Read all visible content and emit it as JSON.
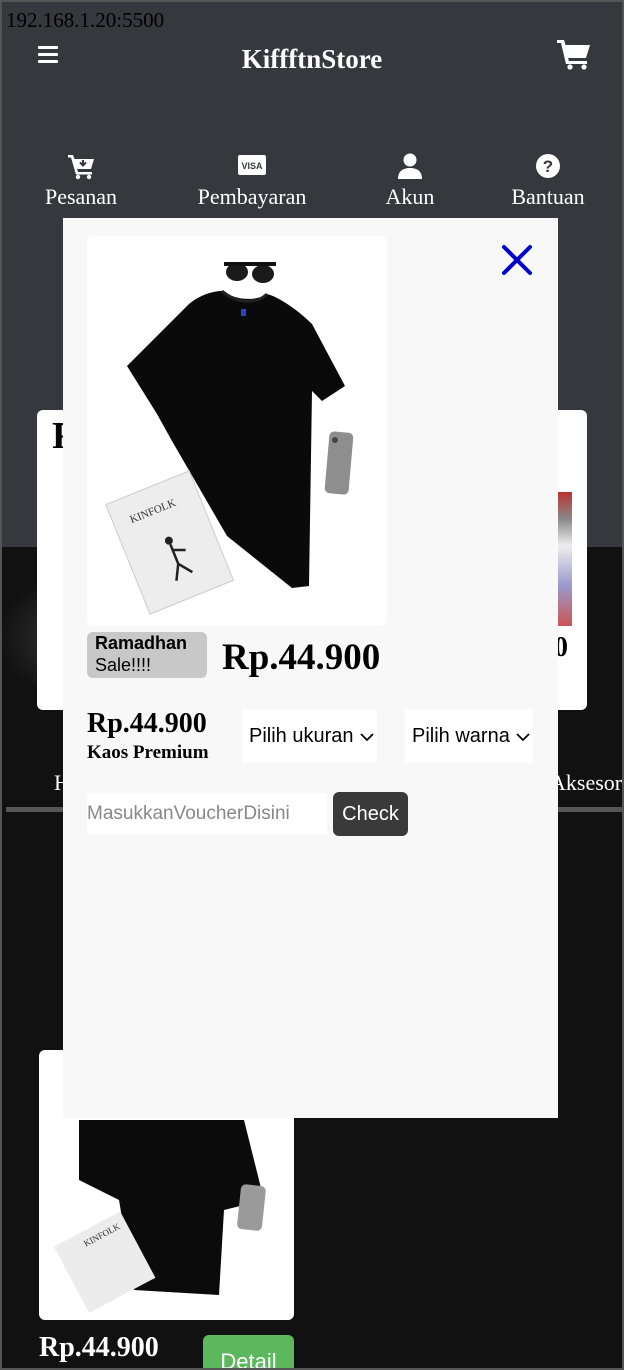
{
  "browser": {
    "url": "192.168.1.20:5500"
  },
  "header": {
    "brand": "KiffftnStore",
    "nav": [
      {
        "label": "Pesanan",
        "icon": "cart-download-icon"
      },
      {
        "label": "Pembayaran",
        "icon": "visa-card-icon"
      },
      {
        "label": "Akun",
        "icon": "user-icon"
      },
      {
        "label": "Bantuan",
        "icon": "question-circle-icon"
      }
    ]
  },
  "background": {
    "card_heading_partial": "F",
    "card_price_partial": "0",
    "category_left_partial": "H",
    "category_right_partial": "Aksesor",
    "product_price": "Rp.44.900",
    "detail_button": "Detail"
  },
  "modal": {
    "badge_line1": "Ramadhan",
    "badge_line2": "Sale!!!!",
    "price_big": "Rp.44.900",
    "price_small": "Rp.44.900",
    "product_name": "Kaos Premium",
    "size_select": "Pilih ukuran",
    "color_select": "Pilih warna",
    "voucher_placeholder": "MasukkanVoucherDisini",
    "check_button": "Check"
  },
  "colors": {
    "header_bg": "#35383c",
    "close_icon": "#0000cc",
    "detail_button": "#5cb85c"
  }
}
